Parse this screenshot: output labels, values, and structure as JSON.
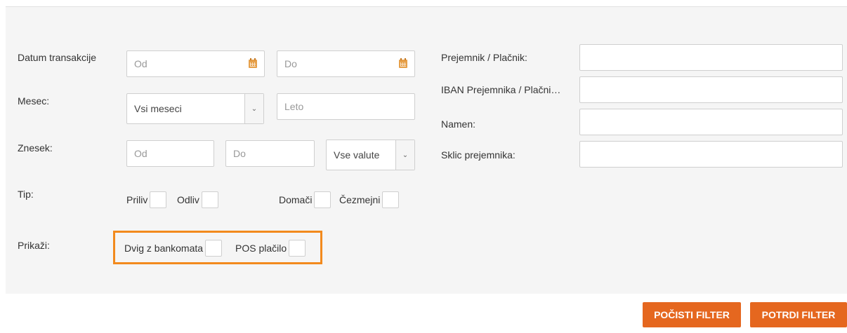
{
  "left": {
    "datum_label": "Datum transakcije",
    "datum_od_placeholder": "Od",
    "datum_do_placeholder": "Do",
    "mesec_label": "Mesec:",
    "mesec_select_value": "Vsi meseci",
    "leto_placeholder": "Leto",
    "znesek_label": "Znesek:",
    "znesek_od_placeholder": "Od",
    "znesek_do_placeholder": "Do",
    "valuta_select_value": "Vse valute",
    "tip_label": "Tip:",
    "priliv_label": "Priliv",
    "odliv_label": "Odliv",
    "domaci_label": "Domači",
    "cezmejni_label": "Čezmejni",
    "prikazi_label": "Prikaži:",
    "dvig_label": "Dvig z bankomata",
    "pos_label": "POS plačilo"
  },
  "right": {
    "prejemnik_label": "Prejemnik / Plačnik:",
    "iban_label": "IBAN Prejemnika / Plačni…",
    "namen_label": "Namen:",
    "sklic_label": "Sklic prejemnika:"
  },
  "buttons": {
    "clear_label": "POČISTI FILTER",
    "confirm_label": "POTRDI FILTER"
  },
  "colors": {
    "accent": "#e5671f",
    "highlight": "#f28a1d"
  },
  "icons": {
    "calendar": "calendar-icon",
    "dropdown": "chevron-down-icon"
  }
}
